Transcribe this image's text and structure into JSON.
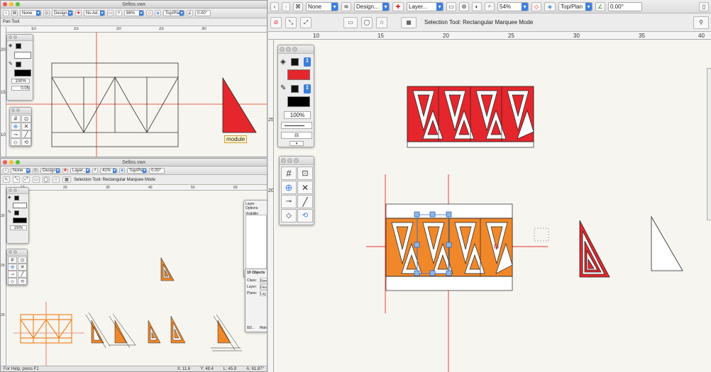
{
  "colors": {
    "red_fill": "#e5262d",
    "orange_fill": "#f0882a",
    "guide": "#e0302a",
    "selection": "#3b7de0",
    "canvas": "#f7f5ef"
  },
  "top_left_window": {
    "title": "Sellos.vwx",
    "toolbar": {
      "class_select": "None",
      "layer_select": "Design...",
      "extra_select": "No Ad...",
      "zoom": "86%",
      "view": "Top/Plan",
      "angle": "0.00°"
    },
    "mode_bar": "Pan Tool",
    "ruler_labels": [
      "10",
      "15",
      "20",
      "25",
      "30"
    ],
    "vruler_labels": [
      "20",
      "15",
      "10"
    ],
    "attributes": {
      "opacity": "100%",
      "line_weight": "0.05"
    },
    "module_label": "module"
  },
  "bottom_left_window": {
    "title": "Sellos.vwx",
    "toolbar": {
      "class_select": "None",
      "layer_select": "Design...",
      "extra_select": "Layer...",
      "zoom": "41%",
      "view": "Top/Plan",
      "angle": "0.00°"
    },
    "mode_bar": "Selection Tool: Rectangular Marquee Mode",
    "ruler_labels": [
      "10",
      "20",
      "30",
      "40",
      "50",
      "60"
    ],
    "vruler_labels": [
      "30",
      "25",
      "20"
    ],
    "attributes": {
      "opacity": "100%"
    },
    "layers_palette": {
      "title": "Layer Options",
      "visibility_label": "Visibility"
    },
    "object_info": {
      "title": "10 Objects",
      "fields": [
        "Class:",
        "Layer:",
        "Plane:"
      ],
      "values": [
        "Non",
        "Des",
        "Lay"
      ],
      "footer": "8/2...",
      "footer_right": "Hide"
    },
    "status": "For Help, press F1",
    "status_values": [
      "X: 11.6",
      "Y: 48.4",
      "L: 45.8",
      "A: 61.87°"
    ]
  },
  "right_window": {
    "toolbar": {
      "class_select": "None",
      "layer_select": "Design...",
      "extra_select": "Layer...",
      "zoom": "54%",
      "view": "Top/Plan",
      "angle": "0.00°"
    },
    "mode_bar": "Selection Tool: Rectangular Marquee Mode",
    "ruler_labels": [
      "10",
      "15",
      "20",
      "25",
      "30",
      "35",
      "40"
    ],
    "vruler_labels": [
      "25",
      "20"
    ],
    "attributes": {
      "opacity": "100%"
    }
  },
  "icons": [
    "pan-icon",
    "pencil-icon",
    "fill-bucket-icon",
    "layers-icon",
    "zoom-icon",
    "selection-arrow-icon",
    "rectangle-icon",
    "lasso-icon",
    "grid-snap-icon"
  ]
}
